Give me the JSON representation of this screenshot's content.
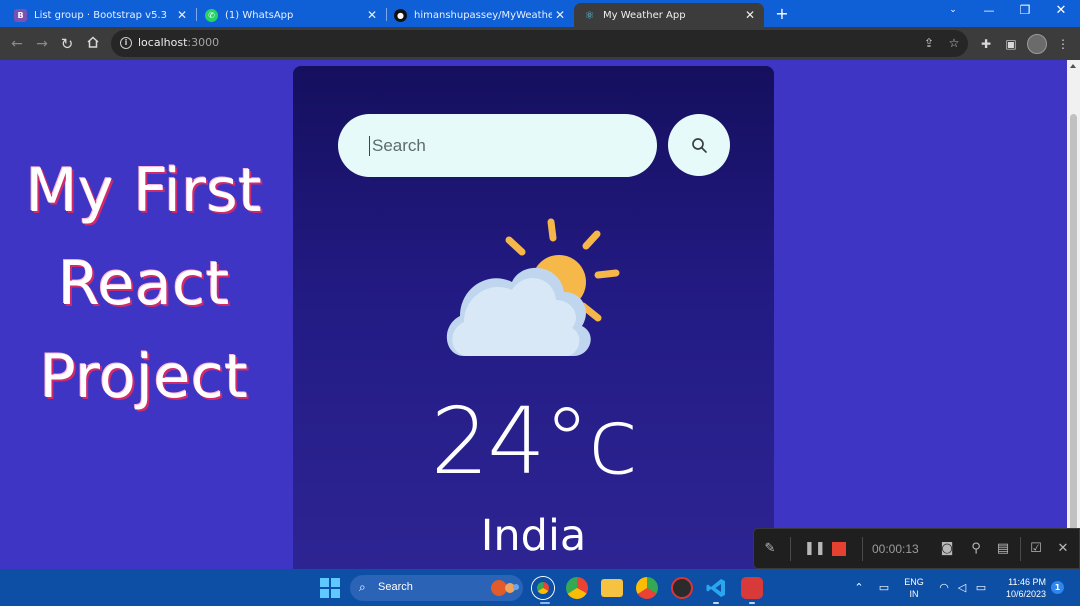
{
  "browser": {
    "tabs": [
      {
        "title": "List group · Bootstrap v5.3",
        "favicon_text": "B",
        "favicon_color": "#7952b3",
        "active": false
      },
      {
        "title": "(1) WhatsApp",
        "favicon_text": "✆",
        "favicon_color": "#25d366",
        "active": false
      },
      {
        "title": "himanshupassey/MyWeatherAp",
        "favicon_text": "●",
        "favicon_color": "#111111",
        "active": false
      },
      {
        "title": "My Weather App",
        "favicon_text": "⚛",
        "favicon_color": "#3c3c3c",
        "active": true
      }
    ],
    "new_tab_label": "+",
    "address": {
      "host": "localhost",
      "port": ":3000"
    }
  },
  "page": {
    "hero_lines": [
      "My First",
      "React",
      "Project"
    ],
    "search": {
      "placeholder": "Search",
      "value": ""
    },
    "weather": {
      "icon": "partly-cloudy-icon",
      "temperature": "24°c",
      "city": "India"
    }
  },
  "recorder": {
    "time": "00:00:13"
  },
  "taskbar": {
    "search_label": "Search",
    "tray": {
      "lang_line1": "ENG",
      "lang_line2": "IN",
      "time": "11:46 PM",
      "date": "10/6/2023",
      "notification_count": "1"
    }
  },
  "colors": {
    "page_bg": "#3f35c4",
    "card_bg": "#1d1673",
    "search_bg": "#e6fbf9",
    "hero_outline": "#d02a6c",
    "tabstrip": "#0f5fd7",
    "taskbar": "#0e4fa6"
  }
}
